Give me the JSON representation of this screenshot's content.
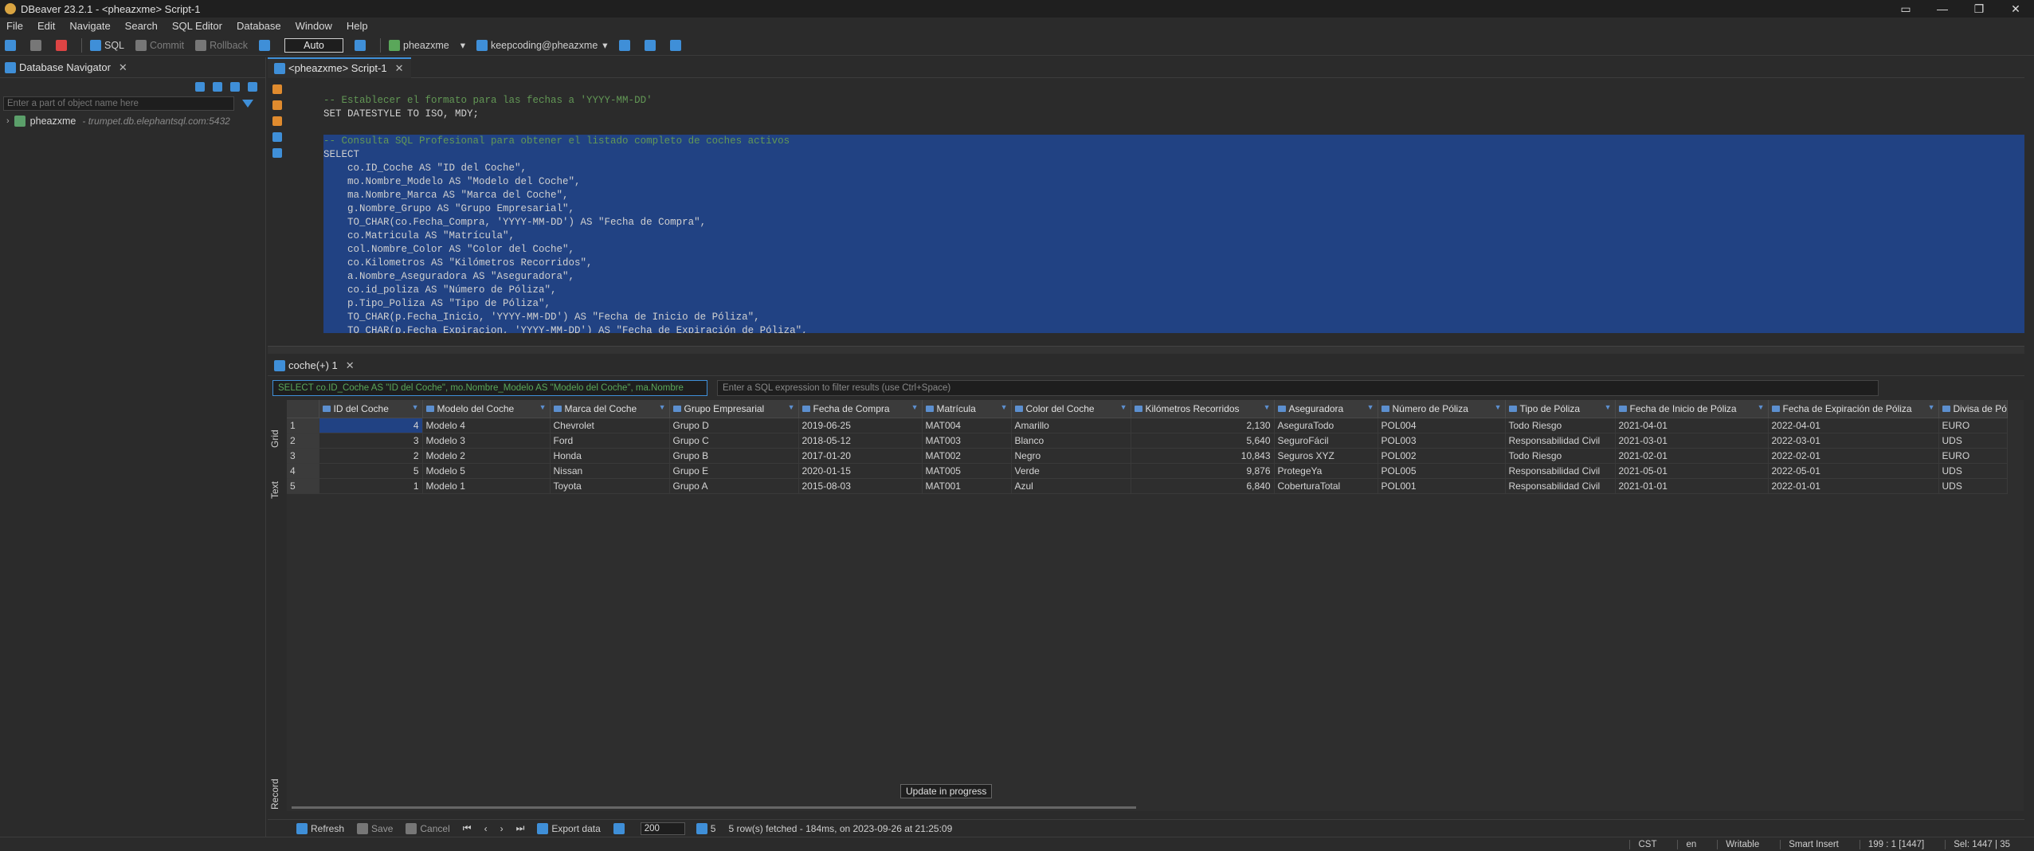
{
  "window": {
    "title": "DBeaver 23.2.1 - <pheazxme> Script-1"
  },
  "menu": [
    "File",
    "Edit",
    "Navigate",
    "Search",
    "SQL Editor",
    "Database",
    "Window",
    "Help"
  ],
  "toolbar": {
    "sql_label": "SQL",
    "commit_label": "Commit",
    "rollback_label": "Rollback",
    "tx_mode": "Auto",
    "connection": "pheazxme",
    "schema": "keepcoding@pheazxme"
  },
  "navigator": {
    "tab_label": "Database Navigator",
    "filter_placeholder": "Enter a part of object name here",
    "connection_name": "pheazxme",
    "connection_host": "- trumpet.db.elephantsql.com:5432"
  },
  "editor": {
    "tab_label": "<pheazxme> Script-1",
    "lines": [
      {
        "text": "-- Establecer el formato para las fechas a 'YYYY-MM-DD'",
        "type": "comment",
        "selected": false
      },
      {
        "text": "SET DATESTYLE TO ISO, MDY;",
        "type": "code",
        "selected": false
      },
      {
        "text": "",
        "type": "code",
        "selected": false
      },
      {
        "text": "-- Consulta SQL Profesional para obtener el listado completo de coches activos",
        "type": "comment",
        "selected": true
      },
      {
        "text": "SELECT",
        "type": "code",
        "selected": true
      },
      {
        "text": "    co.ID_Coche AS \"ID del Coche\",",
        "type": "code",
        "selected": true
      },
      {
        "text": "    mo.Nombre_Modelo AS \"Modelo del Coche\",",
        "type": "code",
        "selected": true
      },
      {
        "text": "    ma.Nombre_Marca AS \"Marca del Coche\",",
        "type": "code",
        "selected": true
      },
      {
        "text": "    g.Nombre_Grupo AS \"Grupo Empresarial\",",
        "type": "code",
        "selected": true
      },
      {
        "text": "    TO_CHAR(co.Fecha_Compra, 'YYYY-MM-DD') AS \"Fecha de Compra\",",
        "type": "code",
        "selected": true
      },
      {
        "text": "    co.Matricula AS \"Matrícula\",",
        "type": "code",
        "selected": true
      },
      {
        "text": "    col.Nombre_Color AS \"Color del Coche\",",
        "type": "code",
        "selected": true
      },
      {
        "text": "    co.Kilometros AS \"Kilómetros Recorridos\",",
        "type": "code",
        "selected": true
      },
      {
        "text": "    a.Nombre_Aseguradora AS \"Aseguradora\",",
        "type": "code",
        "selected": true
      },
      {
        "text": "    co.id_poliza AS \"Número de Póliza\",",
        "type": "code",
        "selected": true
      },
      {
        "text": "    p.Tipo_Poliza AS \"Tipo de Póliza\",",
        "type": "code",
        "selected": true
      },
      {
        "text": "    TO_CHAR(p.Fecha_Inicio, 'YYYY-MM-DD') AS \"Fecha de Inicio de Póliza\",",
        "type": "code",
        "selected": true
      },
      {
        "text": "    TO_CHAR(p.Fecha_Expiracion, 'YYYY-MM-DD') AS \"Fecha de Expiración de Póliza\",",
        "type": "code",
        "selected": true
      }
    ]
  },
  "results": {
    "tab_label": "coche(+) 1",
    "query_filter": "SELECT co.ID_Coche AS \"ID del Coche\", mo.Nombre_Modelo AS \"Modelo del Coche\", ma.Nombre",
    "expr_placeholder": "Enter a SQL expression to filter results (use Ctrl+Space)",
    "side_labels": {
      "grid": "Grid",
      "text": "Text",
      "record": "Record"
    },
    "columns": [
      "ID del Coche",
      "Modelo del Coche",
      "Marca del Coche",
      "Grupo Empresarial",
      "Fecha de Compra",
      "Matrícula",
      "Color del Coche",
      "Kilómetros Recorridos",
      "Aseguradora",
      "Número de Póliza",
      "Tipo de Póliza",
      "Fecha de Inicio de Póliza",
      "Fecha de Expiración de Póliza",
      "Divisa de Pó"
    ],
    "rows": [
      [
        "1",
        "4",
        "Modelo 4",
        "Chevrolet",
        "Grupo D",
        "2019-06-25",
        "MAT004",
        "Amarillo",
        "2,130",
        "AseguraTodo",
        "POL004",
        "Todo Riesgo",
        "2021-04-01",
        "2022-04-01",
        "EURO"
      ],
      [
        "2",
        "3",
        "Modelo 3",
        "Ford",
        "Grupo C",
        "2018-05-12",
        "MAT003",
        "Blanco",
        "5,640",
        "SeguroFácil",
        "POL003",
        "Responsabilidad Civil",
        "2021-03-01",
        "2022-03-01",
        "UDS"
      ],
      [
        "3",
        "2",
        "Modelo 2",
        "Honda",
        "Grupo B",
        "2017-01-20",
        "MAT002",
        "Negro",
        "10,843",
        "Seguros XYZ",
        "POL002",
        "Todo Riesgo",
        "2021-02-01",
        "2022-02-01",
        "EURO"
      ],
      [
        "4",
        "5",
        "Modelo 5",
        "Nissan",
        "Grupo E",
        "2020-01-15",
        "MAT005",
        "Verde",
        "9,876",
        "ProtegeYa",
        "POL005",
        "Responsabilidad Civil",
        "2021-05-01",
        "2022-05-01",
        "UDS"
      ],
      [
        "5",
        "1",
        "Modelo 1",
        "Toyota",
        "Grupo A",
        "2015-08-03",
        "MAT001",
        "Azul",
        "6,840",
        "CoberturaTotal",
        "POL001",
        "Responsabilidad Civil",
        "2021-01-01",
        "2022-01-01",
        "UDS"
      ]
    ],
    "tooltip": "Update in progress",
    "bottom": {
      "refresh": "Refresh",
      "save": "Save",
      "cancel": "Cancel",
      "export": "Export data",
      "limit": "200",
      "count": "5",
      "status": "5 row(s) fetched - 184ms, on 2023-09-26 at 21:25:09"
    }
  },
  "statusbar": [
    "CST",
    "en",
    "Writable",
    "Smart Insert",
    "199 : 1 [1447]",
    "Sel: 1447 | 35"
  ]
}
